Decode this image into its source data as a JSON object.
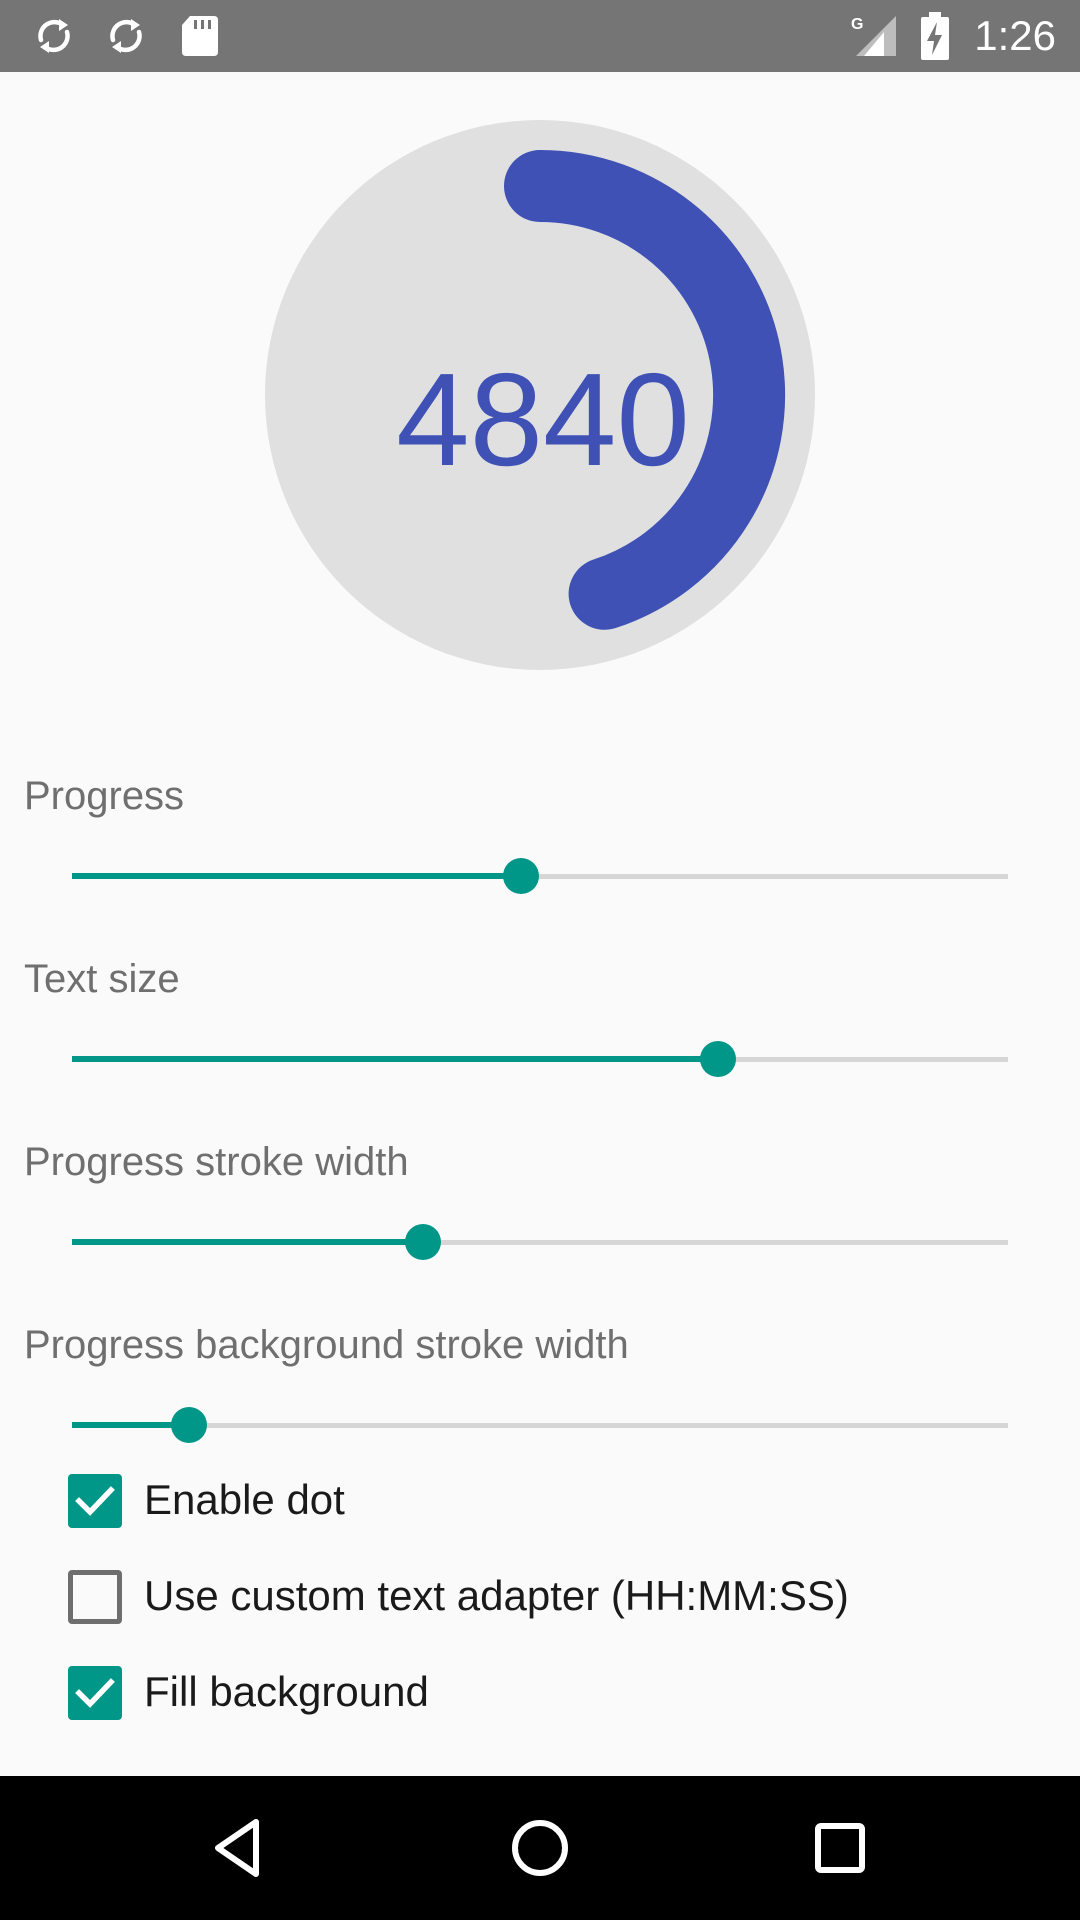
{
  "status_bar": {
    "time": "1:26",
    "network_label": "G",
    "icons": [
      "sync-icon",
      "sync-icon",
      "sd-card-icon",
      "signal-icon",
      "battery-charging-icon"
    ]
  },
  "gauge": {
    "value_text": "4840",
    "progress": 0.45,
    "progress_color": "#3F51B5",
    "background_color": "#E0E0E0",
    "text_color": "#3F51B5"
  },
  "controls": {
    "sliders": [
      {
        "label": "Progress",
        "value": 0.48
      },
      {
        "label": "Text size",
        "value": 0.69
      },
      {
        "label": "Progress stroke width",
        "value": 0.375
      },
      {
        "label": "Progress background stroke width",
        "value": 0.125
      }
    ],
    "checkboxes": [
      {
        "label": "Enable dot",
        "checked": true
      },
      {
        "label": "Use custom text adapter (HH:MM:SS)",
        "checked": false
      },
      {
        "label": "Fill background",
        "checked": true
      }
    ],
    "accent_color": "#009688"
  },
  "nav_bar": {
    "buttons": [
      "back-icon",
      "home-icon",
      "recents-icon"
    ]
  }
}
